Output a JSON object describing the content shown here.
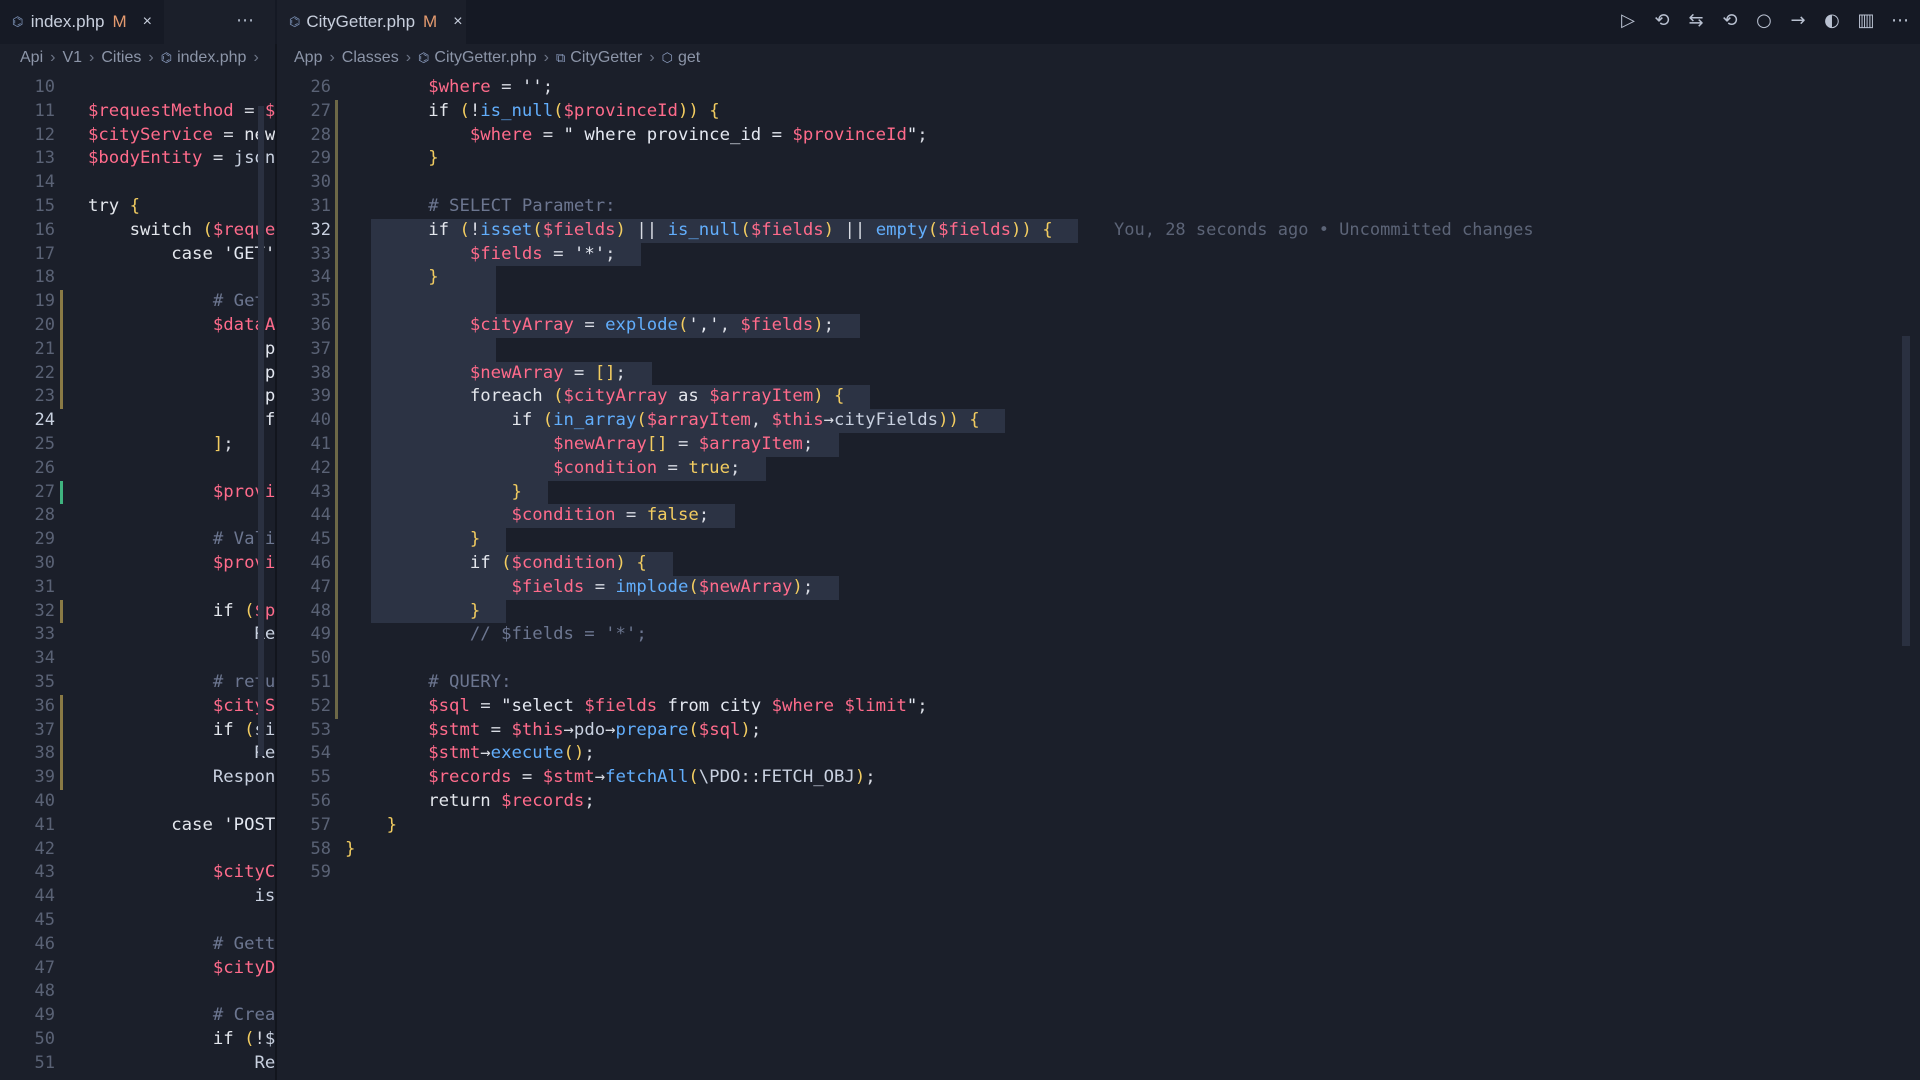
{
  "tabs": {
    "left": {
      "name": "index.php",
      "modified": "M",
      "close": "×",
      "icon": "php-elephant-icon"
    },
    "right": {
      "name": "CityGetter.php",
      "modified": "M",
      "close": "×",
      "icon": "php-elephant-icon"
    },
    "more": "⋯"
  },
  "toolbar": {
    "icons": [
      "run-icon",
      "history-icon",
      "git-compare-icon",
      "go-back-icon",
      "git-commit-icon",
      "go-forward-icon",
      "debug-icon",
      "split-editor-icon",
      "more-icon"
    ],
    "glyphs": [
      "▷",
      "⟲",
      "⇆",
      "⟲",
      "○",
      "→",
      "◐",
      "▥",
      "⋯"
    ]
  },
  "breadcrumbs": {
    "left": [
      "Api",
      "V1",
      "Cities",
      "index.php"
    ],
    "right": [
      "App",
      "Classes",
      "CityGetter.php",
      "CityGetter",
      "get"
    ],
    "sep": "›"
  },
  "left_editor": {
    "line_numbers": [
      "10",
      "11",
      "12",
      "13",
      "14",
      "15",
      "16",
      "17",
      "18",
      "19",
      "20",
      "21",
      "22",
      "23",
      "24",
      "25",
      "26",
      "27",
      "28",
      "29",
      "30",
      "31",
      "32",
      "33",
      "34",
      "35",
      "36",
      "37",
      "38",
      "39",
      "40",
      "41",
      "42",
      "43",
      "44",
      "45",
      "46",
      "47",
      "48",
      "49",
      "50",
      "51"
    ],
    "current_line": "24",
    "lines": [
      "",
      "$requestMethod = $_",
      "$cityService = new",
      "$bodyEntity = json_",
      "",
      "try {",
      "    switch ($reque",
      "        case 'GET'",
      "",
      "            # Get",
      "            $dataA",
      "                'p",
      "                'p",
      "                'p",
      "                'f",
      "            ];",
      "",
      "            $provi",
      "",
      "            # Vali",
      "            $provi",
      "",
      "            if ($p",
      "                Re",
      "",
      "            # retu",
      "            $cityS",
      "            if (si",
      "                Re",
      "            Respon",
      "",
      "        case 'POST",
      "",
      "            $cityC",
      "                is",
      "",
      "            # Gett",
      "            $cityD",
      "",
      "            # Crea",
      "            if (!$",
      "                Re"
    ]
  },
  "right_editor": {
    "line_numbers": [
      "26",
      "27",
      "28",
      "29",
      "30",
      "31",
      "32",
      "33",
      "34",
      "35",
      "36",
      "37",
      "38",
      "39",
      "40",
      "41",
      "42",
      "43",
      "44",
      "45",
      "46",
      "47",
      "48",
      "49",
      "50",
      "51",
      "52",
      "53",
      "54",
      "55",
      "56",
      "57",
      "58",
      "59"
    ],
    "current_line": "32",
    "lines": [
      "        $where = '';",
      "        if (!is_null($provinceId)) {",
      "            $where = \" where province_id = $provinceId\";",
      "        }",
      "",
      "        # SELECT Parametr:",
      "        if (!isset($fields) || is_null($fields) || empty($fields)) {",
      "            $fields = '*';",
      "        }",
      "",
      "            $cityArray = explode(',', $fields);",
      "",
      "            $newArray = [];",
      "            foreach ($cityArray as $arrayItem) {",
      "                if (in_array($arrayItem, $this→cityFields)) {",
      "                    $newArray[] = $arrayItem;",
      "                    $condition = true;",
      "                }",
      "                $condition = false;",
      "            }",
      "            if ($condition) {",
      "                $fields = implode($newArray);",
      "            }",
      "            // $fields = '*';",
      "",
      "        # QUERY:",
      "        $sql = \"select $fields from city $where $limit\";",
      "        $stmt = $this→pdo→prepare($sql);",
      "        $stmt→execute();",
      "        $records = $stmt→fetchAll(\\PDO::FETCH_OBJ);",
      "        return $records;",
      "    }",
      "}",
      ""
    ],
    "blame": "You, 28 seconds ago • Uncommitted changes"
  }
}
